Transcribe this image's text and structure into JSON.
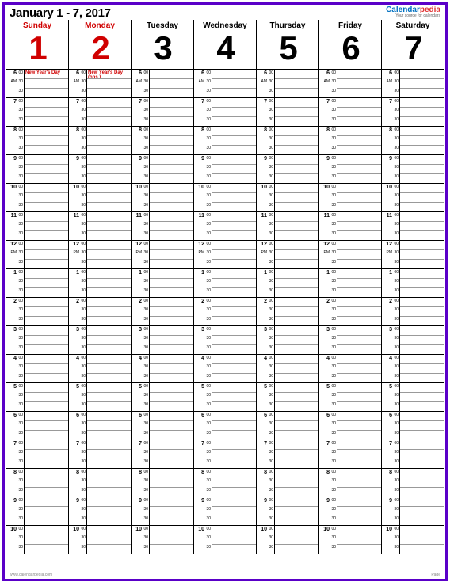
{
  "title": "January 1 - 7, 2017",
  "brand": {
    "part1": "Calendar",
    "part2": "pedia",
    "tag": "Your source for calendars"
  },
  "days": [
    {
      "name": "Sunday",
      "num": "1",
      "highlight": true,
      "event": "New Year's Day"
    },
    {
      "name": "Monday",
      "num": "2",
      "highlight": true,
      "event": "New Year's Day (obs.)"
    },
    {
      "name": "Tuesday",
      "num": "3",
      "highlight": false,
      "event": ""
    },
    {
      "name": "Wednesday",
      "num": "4",
      "highlight": false,
      "event": ""
    },
    {
      "name": "Thursday",
      "num": "5",
      "highlight": false,
      "event": ""
    },
    {
      "name": "Friday",
      "num": "6",
      "highlight": false,
      "event": ""
    },
    {
      "name": "Saturday",
      "num": "7",
      "highlight": false,
      "event": ""
    }
  ],
  "hours": [
    {
      "h": "6",
      "ampm": "AM"
    },
    {
      "h": "7",
      "ampm": ""
    },
    {
      "h": "8",
      "ampm": ""
    },
    {
      "h": "9",
      "ampm": ""
    },
    {
      "h": "10",
      "ampm": ""
    },
    {
      "h": "11",
      "ampm": ""
    },
    {
      "h": "12",
      "ampm": "PM"
    },
    {
      "h": "1",
      "ampm": ""
    },
    {
      "h": "2",
      "ampm": ""
    },
    {
      "h": "3",
      "ampm": ""
    },
    {
      "h": "4",
      "ampm": ""
    },
    {
      "h": "5",
      "ampm": ""
    },
    {
      "h": "6",
      "ampm": ""
    },
    {
      "h": "7",
      "ampm": ""
    },
    {
      "h": "8",
      "ampm": ""
    },
    {
      "h": "9",
      "ampm": ""
    },
    {
      "h": "10",
      "ampm": ""
    }
  ],
  "sub_oo": "00",
  "sub_30": "30",
  "footer": {
    "left": "www.calendarpedia.com",
    "right": "Page"
  }
}
